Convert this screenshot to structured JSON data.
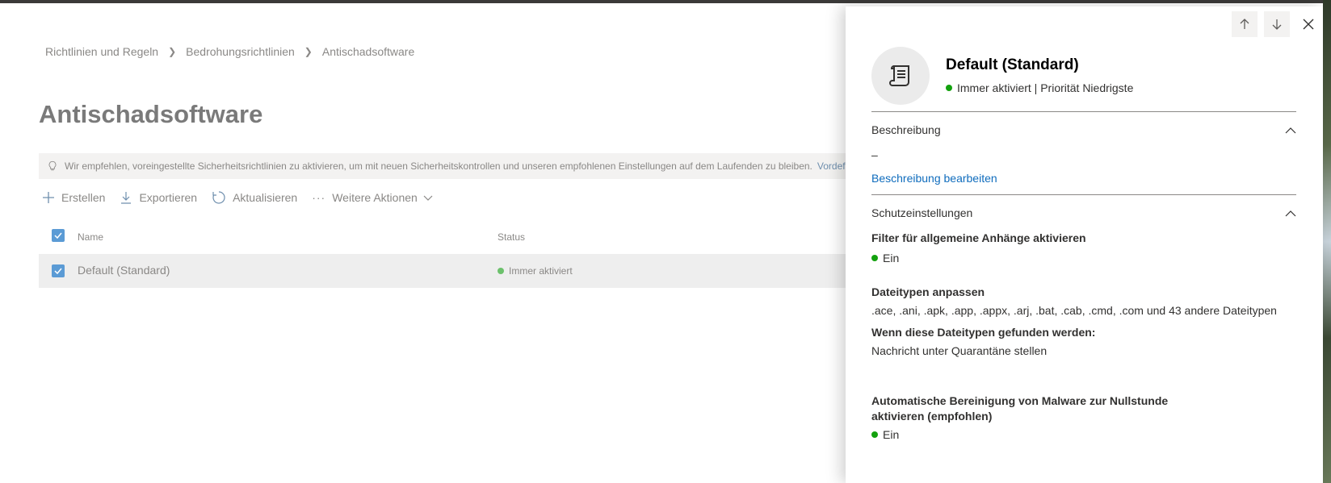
{
  "breadcrumb": [
    "Richtlinien und Regeln",
    "Bedrohungsrichtlinien",
    "Antischadsoftware"
  ],
  "page_title": "Antischadsoftware",
  "banner": {
    "text": "Wir empfehlen, voreingestellte Sicherheitsrichtlinien zu aktivieren, um mit neuen Sicherheitskontrollen und unseren empfohlenen Einstellungen auf dem Laufenden zu bleiben.",
    "link": "Vordef"
  },
  "toolbar": {
    "create": "Erstellen",
    "export": "Exportieren",
    "refresh": "Aktualisieren",
    "more": "Weitere Aktionen"
  },
  "table": {
    "columns": [
      "Name",
      "Status"
    ],
    "rows": [
      {
        "name": "Default (Standard)",
        "status": "Immer aktiviert"
      }
    ]
  },
  "panel": {
    "title": "Default (Standard)",
    "subtitle": "Immer aktiviert | Priorität Niedrigste",
    "description": {
      "heading": "Beschreibung",
      "value": "–",
      "edit_link": "Beschreibung bearbeiten"
    },
    "protection": {
      "heading": "Schutzeinstellungen",
      "common_filter_label": "Filter für allgemeine Anhänge aktivieren",
      "common_filter_value": "Ein",
      "filetypes_label": "Dateitypen anpassen",
      "filetypes_value": ".ace, .ani, .apk, .app, .appx, .arj, .bat, .cab, .cmd, .com und 43 andere Dateitypen",
      "when_found_label": "Wenn diese Dateitypen gefunden werden:",
      "when_found_value": "Nachricht unter Quarantäne stellen",
      "zap_label": "Automatische Bereinigung von Malware zur Nullstunde aktivieren (empfohlen)",
      "zap_value": "Ein"
    }
  },
  "colors": {
    "link": "#0f6cbd",
    "status_green": "#13a10e",
    "checkbox": "#5b9bd5"
  }
}
